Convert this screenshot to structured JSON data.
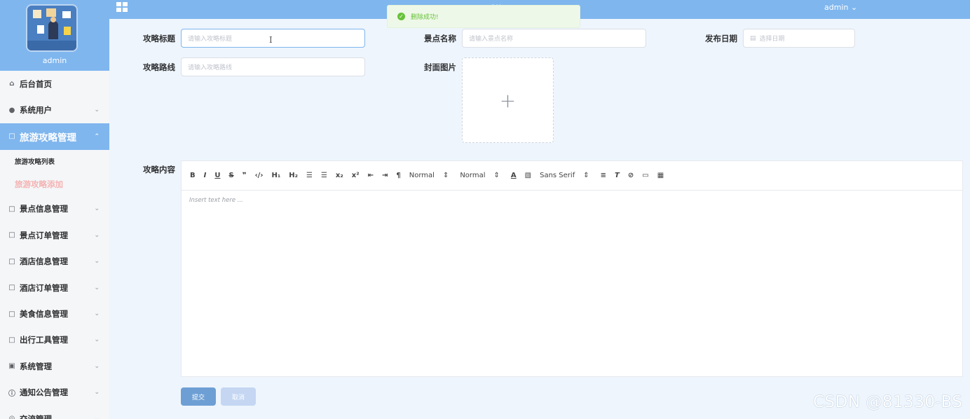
{
  "sidebar": {
    "user": "admin",
    "items": [
      {
        "label": "后台首页",
        "icon": "home-icon"
      },
      {
        "label": "系统用户",
        "icon": "user-icon"
      },
      {
        "label": "旅游攻略管理",
        "icon": "folder-icon"
      },
      {
        "label": "景点信息管理",
        "icon": "folder-icon"
      },
      {
        "label": "景点订单管理",
        "icon": "folder-icon"
      },
      {
        "label": "酒店信息管理",
        "icon": "folder-icon"
      },
      {
        "label": "酒店订单管理",
        "icon": "folder-icon"
      },
      {
        "label": "美食信息管理",
        "icon": "folder-icon"
      },
      {
        "label": "出行工具管理",
        "icon": "folder-icon"
      },
      {
        "label": "系统管理",
        "icon": "settings-icon"
      },
      {
        "label": "通知公告管理",
        "icon": "info-icon"
      },
      {
        "label": "交流管理",
        "icon": "chat-icon"
      }
    ],
    "subitems": [
      {
        "label": "旅游攻略列表"
      },
      {
        "label": "旅游攻略添加"
      }
    ]
  },
  "header": {
    "title": "系统",
    "user": "admin"
  },
  "toast": {
    "message": "删除成功!"
  },
  "form": {
    "title_label": "攻略标题",
    "title_placeholder": "请输入攻略标题",
    "spot_label": "景点名称",
    "spot_placeholder": "请输入景点名称",
    "date_label": "发布日期",
    "date_placeholder": "选择日期",
    "route_label": "攻略路线",
    "route_placeholder": "请输入攻略路线",
    "cover_label": "封面图片",
    "content_label": "攻略内容"
  },
  "editor": {
    "placeholder": "Insert text here ...",
    "size_select": "Normal",
    "header_select": "Normal",
    "font_select": "Sans Serif"
  },
  "buttons": {
    "submit": "提交",
    "cancel": "取消"
  },
  "watermark": "CSDN @81330-BS",
  "colors": {
    "primary": "#7fb6ee",
    "success": "#67c23a",
    "background": "#eef5fd"
  }
}
